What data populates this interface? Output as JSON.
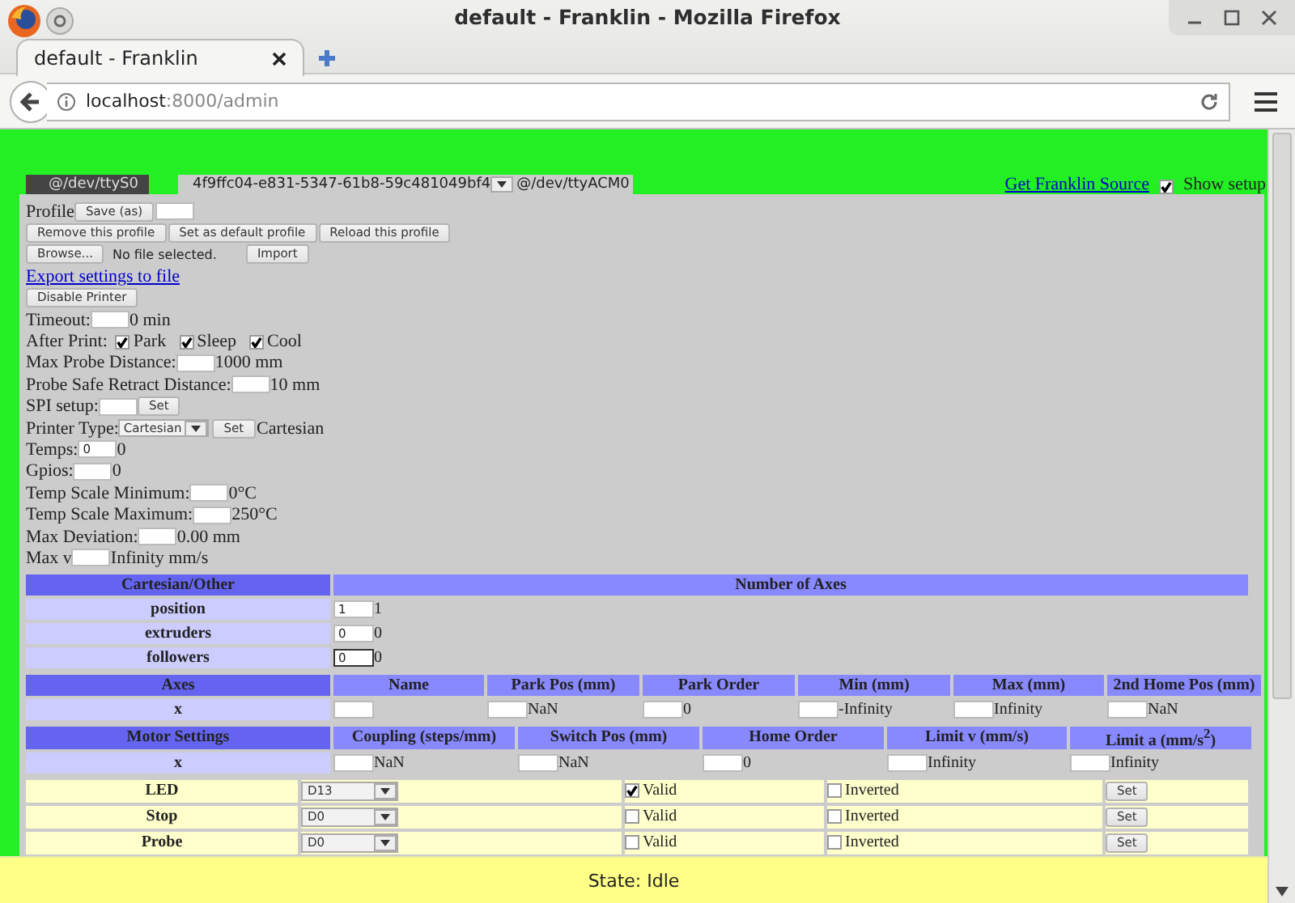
{
  "browser": {
    "window_title": "default - Franklin - Mozilla Firefox",
    "tab_title": "default - Franklin",
    "address_host": "localhost",
    "address_path": ":8000/admin"
  },
  "printer_tabs": [
    {
      "kind": "plain",
      "label": "@/dev/ttyS0",
      "selected": false
    },
    {
      "kind": "uuid",
      "uuid": "4f9ffc04-e831-5347-61b8-59c481049bf4",
      "label": "@/dev/ttyACM0",
      "selected": true
    }
  ],
  "source_link": "Get Franklin Source",
  "show_setup": {
    "label": "Show setup",
    "checked": true
  },
  "profile": {
    "label": "Profile",
    "save_button": "Save (as)",
    "buttons": [
      "Remove this profile",
      "Set as default profile",
      "Reload this profile"
    ]
  },
  "import": {
    "browse_button": "Browse...",
    "file_status": "No file selected.",
    "import_button": "Import"
  },
  "export_link": "Export settings to file",
  "disable_button": "Disable Printer",
  "settings": [
    {
      "kind": "input",
      "label": "Timeout:",
      "value": "0 min"
    },
    {
      "kind": "checks",
      "label": "After Print:",
      "options": [
        {
          "label": "Park",
          "checked": true
        },
        {
          "label": "Sleep",
          "checked": true
        },
        {
          "label": "Cool",
          "checked": true
        }
      ]
    },
    {
      "kind": "input",
      "label": "Max Probe Distance:",
      "value": "1000 mm"
    },
    {
      "kind": "input",
      "label": "Probe Safe Retract Distance:",
      "value": "10 mm"
    },
    {
      "kind": "input_button",
      "label": "SPI setup:",
      "button": "Set"
    },
    {
      "kind": "select_button",
      "label": "Printer Type:",
      "select": "Cartesian",
      "button": "Set",
      "value": "Cartesian"
    },
    {
      "kind": "input",
      "label": "Temps:",
      "input": "0",
      "value": "0"
    },
    {
      "kind": "input",
      "label": "Gpios:",
      "value": "0"
    },
    {
      "kind": "input",
      "label": "Temp Scale Minimum:",
      "value": "0°C"
    },
    {
      "kind": "input",
      "label": "Temp Scale Maximum:",
      "value": "250°C"
    },
    {
      "kind": "input",
      "label": "Max Deviation:",
      "value": "0.00 mm"
    },
    {
      "kind": "input",
      "label": "Max v",
      "value": "Infinity mm/s"
    }
  ],
  "axis_counts": {
    "header_left": "Cartesian/Other",
    "header_right": "Number of Axes",
    "rows": [
      {
        "label": "position",
        "input": "1",
        "value": "1",
        "focused": false
      },
      {
        "label": "extruders",
        "input": "0",
        "value": "0",
        "focused": false
      },
      {
        "label": "followers",
        "input": "0",
        "value": "0",
        "focused": true
      }
    ]
  },
  "axes": {
    "columns": [
      "Axes",
      "Name",
      "Park Pos (mm)",
      "Park Order",
      "Min (mm)",
      "Max (mm)",
      "2nd Home Pos (mm)"
    ],
    "rows": [
      {
        "cells": [
          {
            "kind": "label",
            "value": "x"
          },
          {
            "kind": "input"
          },
          {
            "kind": "input",
            "value": "NaN"
          },
          {
            "kind": "input",
            "value": "0"
          },
          {
            "kind": "input",
            "value": "-Infinity"
          },
          {
            "kind": "input",
            "value": "Infinity"
          },
          {
            "kind": "input",
            "value": "NaN"
          }
        ]
      }
    ]
  },
  "motors": {
    "columns": [
      "Motor Settings",
      "Coupling (steps/mm)",
      "Switch Pos (mm)",
      "Home Order",
      "Limit v (mm/s)",
      "Limit a (mm/s$^{2}$)"
    ],
    "rows": [
      {
        "cells": [
          {
            "kind": "label",
            "value": "x"
          },
          {
            "kind": "input",
            "value": "NaN"
          },
          {
            "kind": "input",
            "value": "NaN"
          },
          {
            "kind": "input",
            "value": "0"
          },
          {
            "kind": "input",
            "value": "Infinity"
          },
          {
            "kind": "input",
            "value": "Infinity"
          }
        ]
      }
    ]
  },
  "pins": [
    {
      "label": "LED",
      "pin": "D13",
      "valid": true,
      "valid_label": "Valid",
      "inverted": false,
      "inverted_label": "Inverted",
      "button": "Set"
    },
    {
      "label": "Stop",
      "pin": "D0",
      "valid": false,
      "valid_label": "Valid",
      "inverted": false,
      "inverted_label": "Inverted",
      "button": "Set"
    },
    {
      "label": "Probe",
      "pin": "D0",
      "valid": false,
      "valid_label": "Valid",
      "inverted": false,
      "inverted_label": "Inverted",
      "button": "Set"
    }
  ],
  "status": "State: Idle"
}
